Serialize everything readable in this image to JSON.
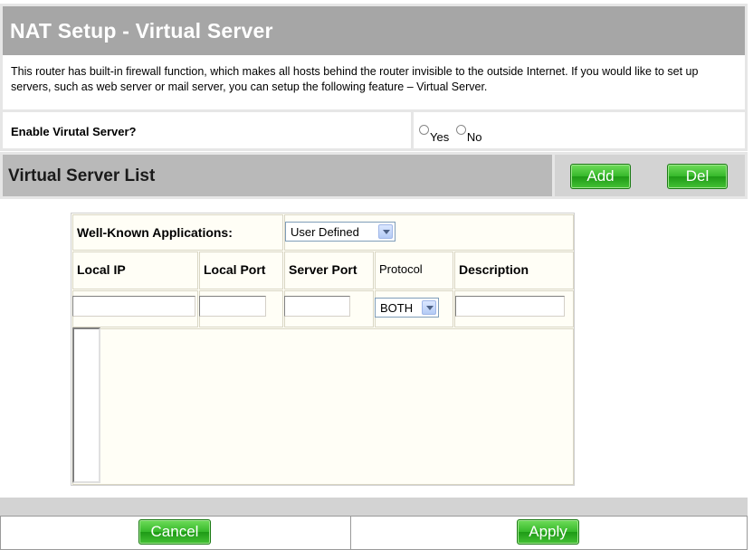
{
  "header": {
    "title": "NAT Setup - Virtual Server"
  },
  "intro": {
    "text": "This router has built-in firewall function, which makes all hosts behind the router invisible to the outside Internet. If you would like to set up servers, such as web server or mail server, you can setup the following feature – Virtual Server."
  },
  "enable": {
    "label": "Enable Virutal Server?",
    "options": [
      "Yes",
      "No"
    ]
  },
  "list": {
    "title": "Virtual Server List",
    "add_label": "Add",
    "del_label": "Del"
  },
  "table": {
    "well_known_label": "Well-Known Applications:",
    "well_known_value": "User Defined",
    "headers": {
      "local_ip": "Local IP",
      "local_port": "Local Port",
      "server_port": "Server Port",
      "protocol": "Protocol",
      "description": "Description"
    },
    "protocol_value": "BOTH"
  },
  "footer": {
    "cancel_label": "Cancel",
    "apply_label": "Apply"
  },
  "colors": {
    "title_bar": "#a6a6a6",
    "list_bar": "#b9b9b9",
    "button_green": "#36b82a",
    "table_bg": "#fffef6"
  }
}
